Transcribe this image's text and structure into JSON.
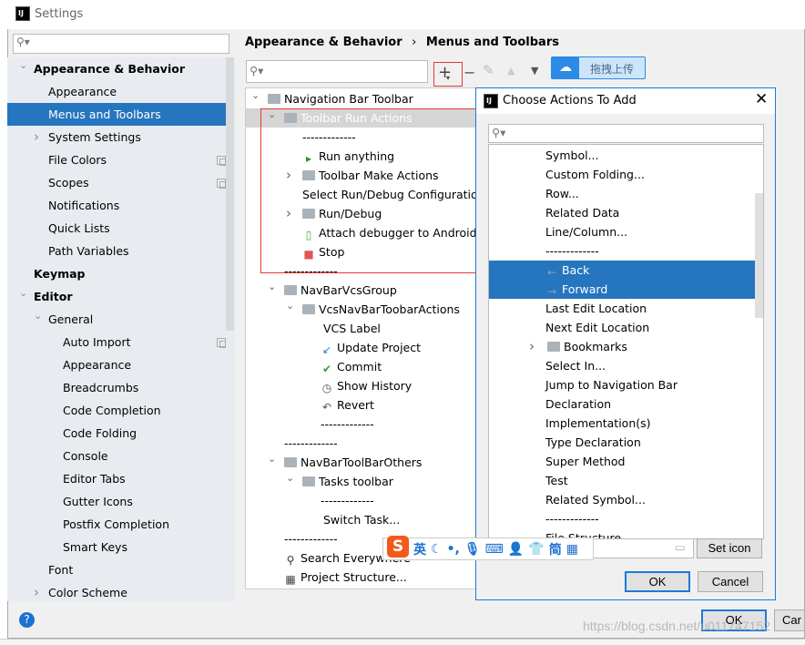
{
  "window": {
    "title": "Settings"
  },
  "sidebar": {
    "items": [
      {
        "label": "Appearance & Behavior",
        "level": 0,
        "bold": true,
        "arrow": "expanded"
      },
      {
        "label": "Appearance",
        "level": 1
      },
      {
        "label": "Menus and Toolbars",
        "level": 1,
        "selected": true
      },
      {
        "label": "System Settings",
        "level": 1,
        "arrow": "collapsed"
      },
      {
        "label": "File Colors",
        "level": 1,
        "copy": true
      },
      {
        "label": "Scopes",
        "level": 1,
        "copy": true
      },
      {
        "label": "Notifications",
        "level": 1
      },
      {
        "label": "Quick Lists",
        "level": 1
      },
      {
        "label": "Path Variables",
        "level": 1
      },
      {
        "label": "Keymap",
        "level": 0,
        "bold": true
      },
      {
        "label": "Editor",
        "level": 0,
        "bold": true,
        "arrow": "expanded"
      },
      {
        "label": "General",
        "level": 1,
        "arrow": "expanded"
      },
      {
        "label": "Auto Import",
        "level": 2,
        "copy": true
      },
      {
        "label": "Appearance",
        "level": 2
      },
      {
        "label": "Breadcrumbs",
        "level": 2
      },
      {
        "label": "Code Completion",
        "level": 2
      },
      {
        "label": "Code Folding",
        "level": 2
      },
      {
        "label": "Console",
        "level": 2
      },
      {
        "label": "Editor Tabs",
        "level": 2
      },
      {
        "label": "Gutter Icons",
        "level": 2
      },
      {
        "label": "Postfix Completion",
        "level": 2
      },
      {
        "label": "Smart Keys",
        "level": 2
      },
      {
        "label": "Font",
        "level": 1
      },
      {
        "label": "Color Scheme",
        "level": 1,
        "arrow": "collapsed"
      }
    ]
  },
  "breadcrumb": {
    "parent": "Appearance & Behavior",
    "separator": "›",
    "current": "Menus and Toolbars"
  },
  "upload_button": {
    "label": "拖拽上传"
  },
  "tree": [
    {
      "label": "Navigation Bar Toolbar",
      "x": 0,
      "arrow": "expanded",
      "icon": "folder"
    },
    {
      "label": "Toolbar Run Actions",
      "x": 1,
      "arrow": "expanded",
      "icon": "folder",
      "selected": true
    },
    {
      "label": "-------------",
      "x": 2
    },
    {
      "label": "Run anything",
      "x": 2,
      "icon": "run-anything"
    },
    {
      "label": "Toolbar Make Actions",
      "x": 2,
      "arrow": "collapsed",
      "icon": "folder"
    },
    {
      "label": "Select Run/Debug Configuration",
      "x": 2
    },
    {
      "label": "Run/Debug",
      "x": 2,
      "arrow": "collapsed",
      "icon": "folder"
    },
    {
      "label": "Attach debugger to Android p",
      "x": 2,
      "icon": "attach-debugger"
    },
    {
      "label": "Stop",
      "x": 2,
      "icon": "stop"
    },
    {
      "label": "-------------",
      "x": 1
    },
    {
      "label": "NavBarVcsGroup",
      "x": 1,
      "arrow": "expanded",
      "icon": "folder"
    },
    {
      "label": "VcsNavBarToobarActions",
      "x": 2,
      "arrow": "expanded",
      "icon": "folder"
    },
    {
      "label": "VCS Label",
      "x": 3
    },
    {
      "label": "Update Project",
      "x": 3,
      "icon": "update"
    },
    {
      "label": "Commit",
      "x": 3,
      "icon": "commit"
    },
    {
      "label": "Show History",
      "x": 3,
      "icon": "history"
    },
    {
      "label": "Revert",
      "x": 3,
      "icon": "revert"
    },
    {
      "label": "-------------",
      "x": 3
    },
    {
      "label": "-------------",
      "x": 1
    },
    {
      "label": "NavBarToolBarOthers",
      "x": 1,
      "arrow": "expanded",
      "icon": "folder"
    },
    {
      "label": "Tasks toolbar",
      "x": 2,
      "arrow": "expanded",
      "icon": "folder"
    },
    {
      "label": "-------------",
      "x": 3
    },
    {
      "label": "Switch Task...",
      "x": 3
    },
    {
      "label": "-------------",
      "x": 1
    },
    {
      "label": "Search Everywhere",
      "x": 1,
      "icon": "search"
    },
    {
      "label": "Project Structure...",
      "x": 1,
      "icon": "project-structure"
    }
  ],
  "dialog": {
    "title": "Choose Actions To Add",
    "items": [
      {
        "label": "Symbol..."
      },
      {
        "label": "Custom Folding..."
      },
      {
        "label": "Row..."
      },
      {
        "label": "Related Data"
      },
      {
        "label": "Line/Column..."
      },
      {
        "label": "-------------"
      },
      {
        "label": "Back",
        "icon": "arrow-left",
        "selected": true
      },
      {
        "label": "Forward",
        "icon": "arrow-right",
        "selected": true
      },
      {
        "label": "Last Edit Location"
      },
      {
        "label": "Next Edit Location"
      },
      {
        "label": "Bookmarks",
        "arrow": "collapsed",
        "icon": "folder"
      },
      {
        "label": "Select In..."
      },
      {
        "label": "Jump to Navigation Bar"
      },
      {
        "label": "Declaration"
      },
      {
        "label": "Implementation(s)"
      },
      {
        "label": "Type Declaration"
      },
      {
        "label": "Super Method"
      },
      {
        "label": "Test"
      },
      {
        "label": "Related Symbol..."
      },
      {
        "label": "-------------"
      },
      {
        "label": "File Structure"
      }
    ],
    "set_icon": "Set icon",
    "ok": "OK",
    "cancel": "Cancel"
  },
  "ime": {
    "lang": "英",
    "simplified": "简"
  },
  "footer": {
    "ok": "OK",
    "cancel": "Car"
  },
  "watermark": "https://blog.csdn.net/u011747152",
  "colors": {
    "selection": "#2675bf",
    "highlight_box": "#e53935",
    "dialog_border": "#1e7ad6"
  }
}
